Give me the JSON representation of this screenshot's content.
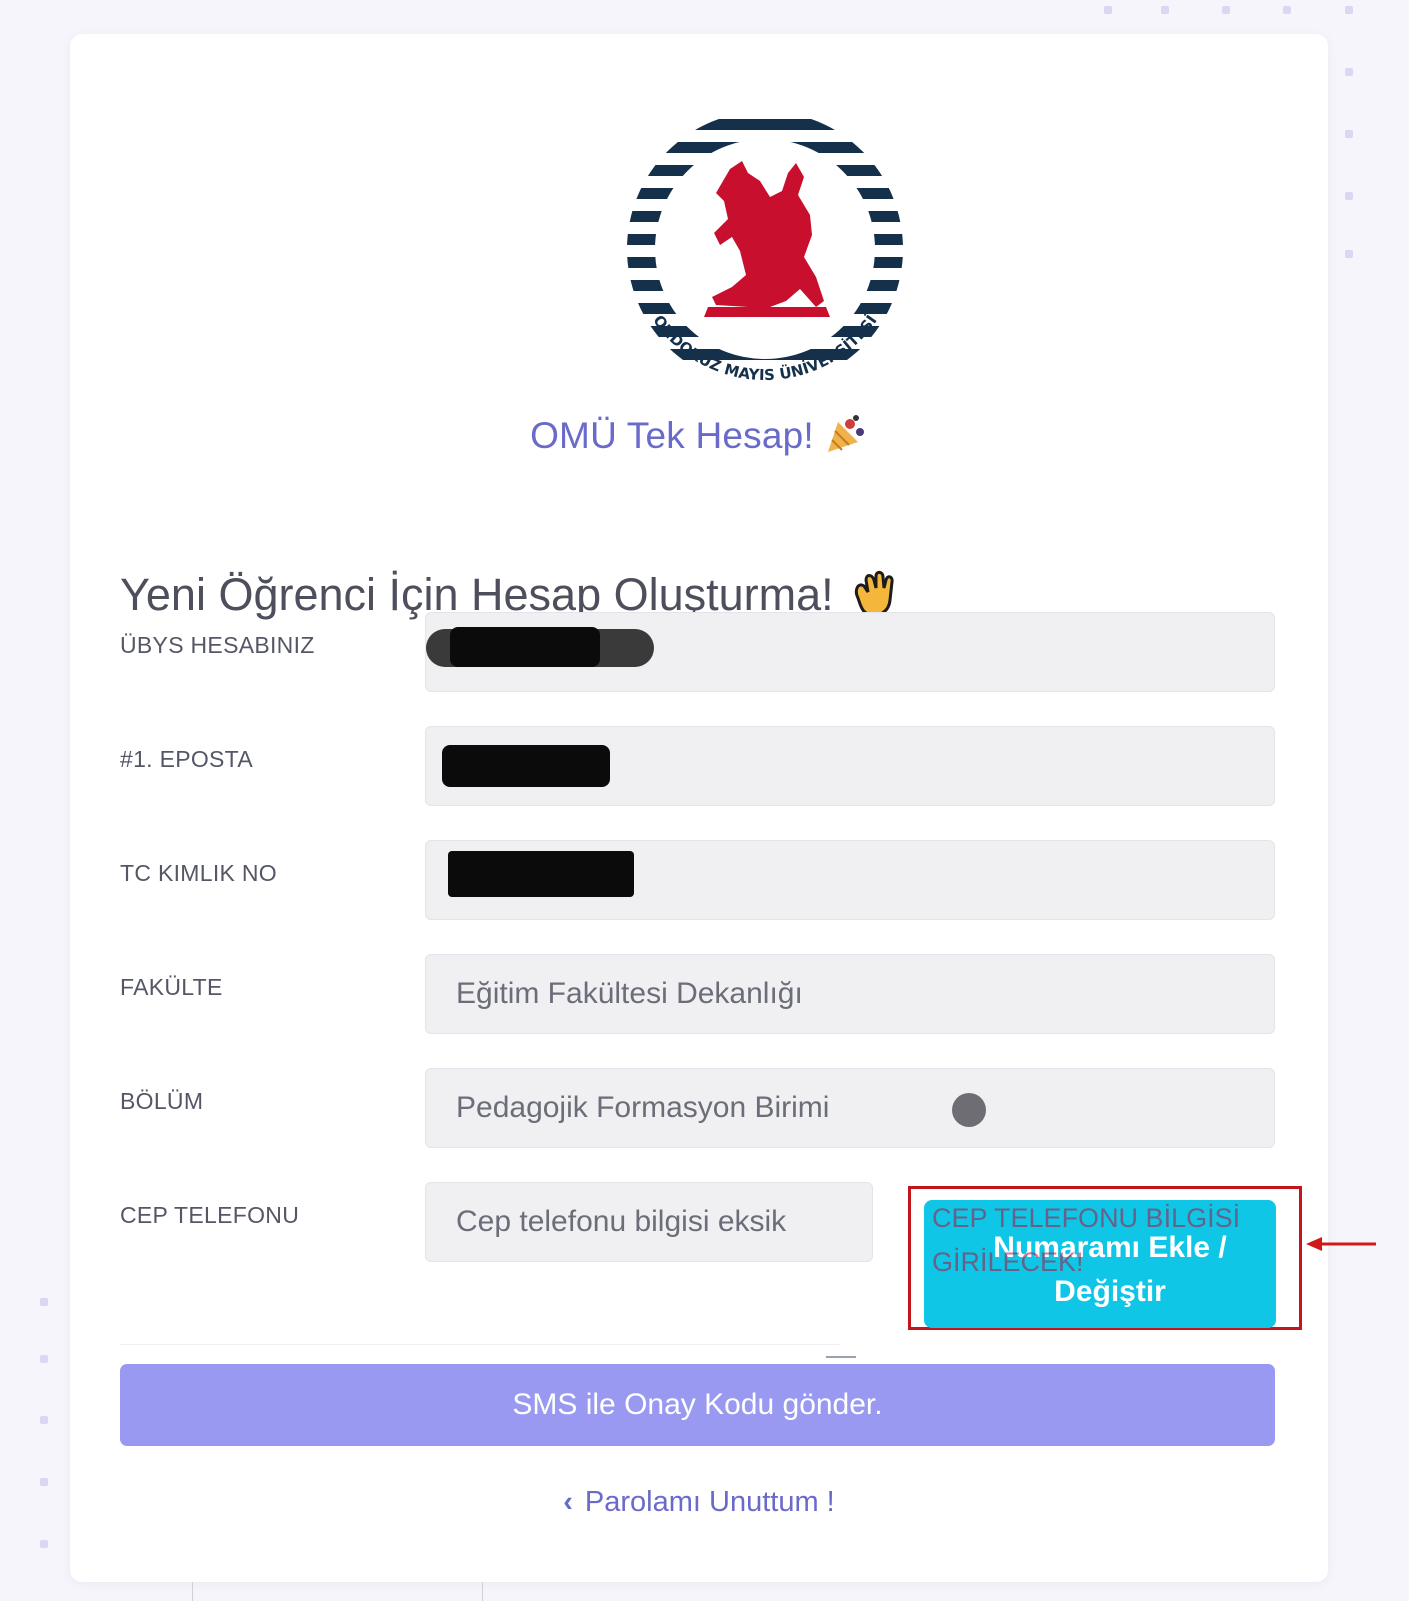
{
  "brand": {
    "title": "OMÜ Tek Hesap!",
    "logo_text": "ONDOKUZ MAYIS ÜNİVERSİTESİ",
    "confetti_icon": "party-popper-icon"
  },
  "form": {
    "heading": "Yeni Öğrenci İçin Hesap Oluşturma!",
    "heading_icon": "waving-hand-icon",
    "rows": [
      {
        "label": "ÜBYS HESABINIZ",
        "value": ""
      },
      {
        "label": "#1. EPOSTA",
        "value": ""
      },
      {
        "label": "TC KIMLIK NO",
        "value": ""
      },
      {
        "label": "FAKÜLTE",
        "value": "Eğitim Fakültesi Dekanlığı"
      },
      {
        "label": "BÖLÜM",
        "value": "Pedagojik Formasyon Birimi"
      },
      {
        "label": "CEP TELEFONU",
        "value": "Cep telefonu bilgisi eksik"
      }
    ],
    "phone_button": "Numaramı Ekle / Değiştir",
    "phone_warning": "CEP TELEFONU BİLGİSİ GİRİLECEK!",
    "sms_button": "SMS ile Onay Kodu gönder.",
    "forgot_link": "Parolamı Unuttum !"
  },
  "colors": {
    "accent": "#6a6acb",
    "sms_button": "#9a99f2",
    "phone_button": "#0fc6e6",
    "annotation_red": "#c3161c",
    "logo_red": "#c8102e",
    "logo_navy": "#14304a"
  }
}
